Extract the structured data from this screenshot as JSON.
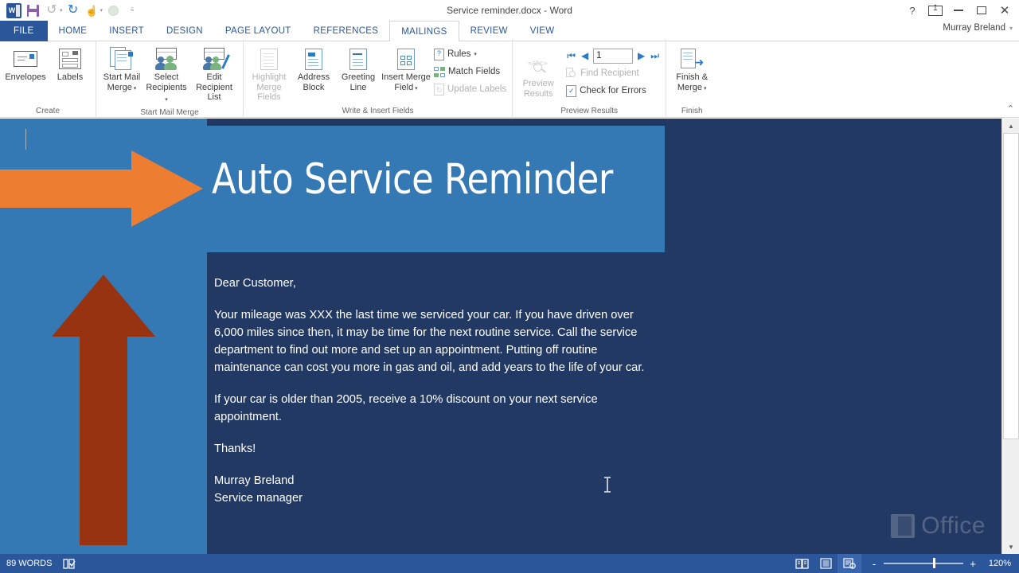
{
  "window": {
    "title": "Service reminder.docx - Word",
    "user": "Murray Breland",
    "help_icon": "question-mark-icon",
    "ribbon_display_icon": "ribbon-display-options-icon",
    "minimize_icon": "minimize-icon",
    "restore_icon": "restore-icon",
    "close_icon": "close-icon"
  },
  "quick_access": {
    "app_logo": "word-logo",
    "items": [
      {
        "name": "save-button",
        "icon": "save-icon",
        "label": "Save",
        "enabled": true
      },
      {
        "name": "undo-button",
        "icon": "undo-icon",
        "label": "Undo",
        "enabled": false
      },
      {
        "name": "redo-button",
        "icon": "redo-icon",
        "label": "Repeat",
        "enabled": true
      },
      {
        "name": "touch-mode-button",
        "icon": "touch-mode-icon",
        "label": "Touch/Mouse Mode",
        "enabled": true
      },
      {
        "name": "customize-qat-button",
        "icon": "chevron-down-icon",
        "label": "Customize Quick Access Toolbar",
        "enabled": true
      }
    ]
  },
  "tabs": [
    {
      "label": "FILE",
      "active": false,
      "file": true
    },
    {
      "label": "HOME",
      "active": false
    },
    {
      "label": "INSERT",
      "active": false
    },
    {
      "label": "DESIGN",
      "active": false
    },
    {
      "label": "PAGE LAYOUT",
      "active": false
    },
    {
      "label": "REFERENCES",
      "active": false
    },
    {
      "label": "MAILINGS",
      "active": true
    },
    {
      "label": "REVIEW",
      "active": false
    },
    {
      "label": "VIEW",
      "active": false
    }
  ],
  "ribbon": {
    "collapse_label": "^",
    "groups": [
      {
        "name": "create",
        "label": "Create",
        "buttons": [
          {
            "label": "Envelopes",
            "icon": "envelope-icon",
            "enabled": true,
            "dropdown": false
          },
          {
            "label": "Labels",
            "icon": "labels-icon",
            "enabled": true,
            "dropdown": false
          }
        ]
      },
      {
        "name": "start-mail-merge",
        "label": "Start Mail Merge",
        "buttons": [
          {
            "label": "Start Mail\nMerge",
            "line1": "Start Mail",
            "line2": "Merge",
            "icon": "start-mail-merge-icon",
            "enabled": true,
            "dropdown": true
          },
          {
            "label": "Select\nRecipients",
            "line1": "Select",
            "line2": "Recipients",
            "icon": "select-recipients-icon",
            "enabled": true,
            "dropdown": true
          },
          {
            "label": "Edit\nRecipient List",
            "line1": "Edit",
            "line2": "Recipient List",
            "icon": "edit-recipient-list-icon",
            "enabled": true,
            "dropdown": false
          }
        ]
      },
      {
        "name": "write-insert-fields",
        "label": "Write & Insert Fields",
        "buttons": [
          {
            "label": "Highlight\nMerge Fields",
            "line1": "Highlight",
            "line2": "Merge Fields",
            "icon": "highlight-merge-fields-icon",
            "enabled": false,
            "dropdown": false
          },
          {
            "label": "Address\nBlock",
            "line1": "Address",
            "line2": "Block",
            "icon": "address-block-icon",
            "enabled": true,
            "dropdown": false
          },
          {
            "label": "Greeting\nLine",
            "line1": "Greeting",
            "line2": "Line",
            "icon": "greeting-line-icon",
            "enabled": true,
            "dropdown": false
          },
          {
            "label": "Insert Merge\nField",
            "line1": "Insert Merge",
            "line2": "Field",
            "icon": "insert-merge-field-icon",
            "enabled": true,
            "dropdown": true
          }
        ],
        "small_buttons": [
          {
            "label": "Rules",
            "icon": "rules-icon",
            "enabled": true,
            "dropdown": true
          },
          {
            "label": "Match Fields",
            "icon": "match-fields-icon",
            "enabled": true,
            "dropdown": false
          },
          {
            "label": "Update Labels",
            "icon": "update-labels-icon",
            "enabled": false,
            "dropdown": false
          }
        ]
      },
      {
        "name": "preview-results",
        "label": "Preview Results",
        "buttons": [
          {
            "label": "Preview\nResults",
            "line1": "Preview",
            "line2": "Results",
            "icon": "preview-results-icon",
            "enabled": false,
            "dropdown": false
          }
        ],
        "record_nav": {
          "first": "first-record-icon",
          "previous": "previous-record-icon",
          "value": "1",
          "next": "next-record-icon",
          "last": "last-record-icon"
        },
        "small_buttons": [
          {
            "label": "Find Recipient",
            "icon": "find-recipient-icon",
            "enabled": false,
            "dropdown": false
          },
          {
            "label": "Check for Errors",
            "icon": "check-for-errors-icon",
            "enabled": true,
            "dropdown": false
          }
        ]
      },
      {
        "name": "finish",
        "label": "Finish",
        "buttons": [
          {
            "label": "Finish &\nMerge",
            "line1": "Finish &",
            "line2": "Merge",
            "icon": "finish-and-merge-icon",
            "enabled": true,
            "dropdown": true
          }
        ]
      }
    ]
  },
  "document": {
    "banner_title": "Auto Service Reminder",
    "watermark": "Office",
    "paragraphs": [
      "Dear Customer,",
      "Your mileage was XXX the last time we serviced your car. If you have driven over 6,000 miles since then, it may be time for the next routine service. Call the service department to find out more and set up an appointment. Putting off routine maintenance can cost you more in gas and oil, and add years to the life of your car.",
      "If your car is older than 2005, receive a 10% discount on your next service appointment.",
      "Thanks!"
    ],
    "signature_name": "Murray Breland",
    "signature_title": "Service manager",
    "colors": {
      "page_background": "#223963",
      "banner_blue": "#3478b4",
      "arrow_orange": "#ed7d31",
      "arrow_dark_red": "#983311",
      "text": "#ffffff"
    }
  },
  "status_bar": {
    "word_count": "89 WORDS",
    "proofing_icon": "proofing-errors-icon",
    "views": [
      {
        "name": "read-mode",
        "icon": "read-mode-icon",
        "active": false
      },
      {
        "name": "print-layout",
        "icon": "print-layout-icon",
        "active": false
      },
      {
        "name": "web-layout",
        "icon": "web-layout-icon",
        "active": true
      }
    ],
    "zoom_out_label": "-",
    "zoom_in_label": "+",
    "zoom_level": "120%"
  },
  "scrollbar": {
    "up_arrow": "scroll-up-icon",
    "down_arrow": "scroll-down-icon"
  }
}
